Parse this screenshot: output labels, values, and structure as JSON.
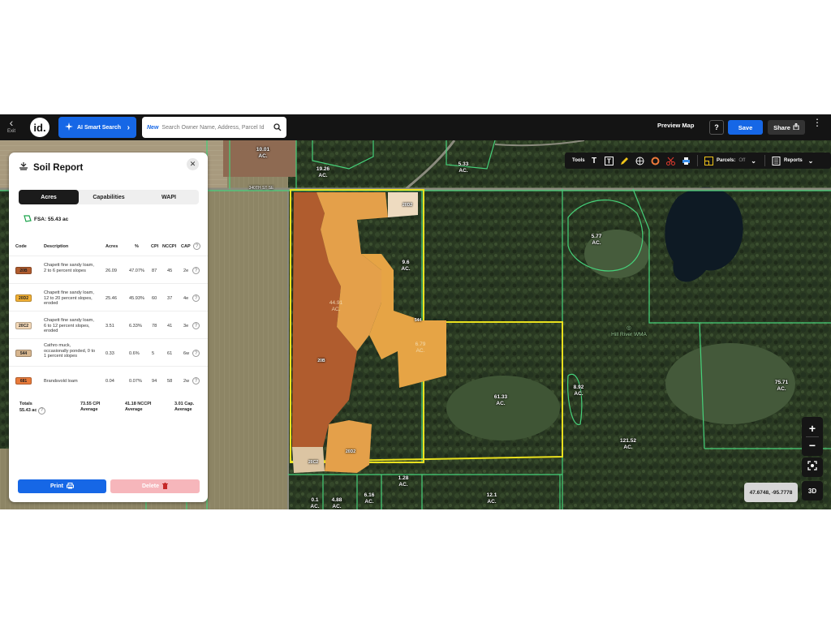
{
  "topbar": {
    "exit_label": "Exit",
    "logo_text": "id.",
    "ai_search_label": "AI Smart Search",
    "search_badge": "New",
    "search_placeholder": "Search Owner Name, Address, Parcel Id",
    "preview_label": "Preview Map",
    "help_label": "?",
    "save_label": "Save",
    "share_label": "Share"
  },
  "toolbar": {
    "tools_label": "Tools",
    "parcels_label": "Parcels:",
    "parcels_state": "Off",
    "reports_label": "Reports"
  },
  "map": {
    "acreage_labels": [
      {
        "value": "10.01",
        "unit": "AC."
      },
      {
        "value": "19.26",
        "unit": "AC."
      },
      {
        "value": "5.33",
        "unit": "AC."
      },
      {
        "value": "9.6",
        "unit": "AC."
      },
      {
        "value": "5.77",
        "unit": "AC."
      },
      {
        "value": "61.33",
        "unit": "AC."
      },
      {
        "value": "8.92",
        "unit": "AC."
      },
      {
        "value": "75.71",
        "unit": "AC."
      },
      {
        "value": "121.52",
        "unit": "AC."
      },
      {
        "value": "1.28",
        "unit": "AC."
      },
      {
        "value": "0.1",
        "unit": "AC."
      },
      {
        "value": "4.88",
        "unit": "AC."
      },
      {
        "value": "6.16",
        "unit": "AC."
      },
      {
        "value": "12.1",
        "unit": "AC."
      }
    ],
    "soil_labels": [
      {
        "value": "44.91",
        "unit": "AC."
      },
      {
        "value": "6.79",
        "unit": "AC."
      }
    ],
    "zone_codes": [
      "20B",
      "20D2",
      "20C2",
      "544",
      "20D2"
    ],
    "road_label": "340TH ST SE",
    "wma_label": "Hill River WMA",
    "coordinates": "47.6748, -95.7778",
    "zoom_in": "+",
    "zoom_out": "−",
    "three_d": "3D"
  },
  "panel": {
    "title": "Soil Report",
    "tabs": [
      {
        "label": "Acres",
        "active": true
      },
      {
        "label": "Capabilities",
        "active": false
      },
      {
        "label": "WAPI",
        "active": false
      }
    ],
    "fsa": "FSA: 55.43 ac",
    "columns": [
      "Code",
      "Description",
      "Acres",
      "%",
      "CPI",
      "NCCPI",
      "CAP"
    ],
    "rows": [
      {
        "code": "20B",
        "color": "#b05c2e",
        "description": "Chapett fine sandy loam, 2 to 6 percent slopes",
        "acres": "26.09",
        "pct": "47.07%",
        "cpi": "87",
        "nccpi": "45",
        "cap": "2e"
      },
      {
        "code": "20D2",
        "color": "#f2b035",
        "description": "Chapett fine sandy loam, 12 to 20 percent slopes, eroded",
        "acres": "25.46",
        "pct": "45.93%",
        "cpi": "60",
        "nccpi": "37",
        "cap": "4e"
      },
      {
        "code": "20C2",
        "color": "#f3d8b7",
        "description": "Chapett fine sandy loam, 6 to 12 percent slopes, eroded",
        "acres": "3.51",
        "pct": "6.33%",
        "cpi": "78",
        "nccpi": "41",
        "cap": "3e"
      },
      {
        "code": "544",
        "color": "#d6b58e",
        "description": "Cathro muck, occasionally ponded, 0 to 1 percent slopes",
        "acres": "0.33",
        "pct": "0.6%",
        "cpi": "5",
        "nccpi": "61",
        "cap": "6w"
      },
      {
        "code": "681",
        "color": "#e87a3a",
        "description": "Brandsvold loam",
        "acres": "0.04",
        "pct": "0.07%",
        "cpi": "94",
        "nccpi": "58",
        "cap": "2w"
      }
    ],
    "totals": {
      "label": "Totals",
      "acres": "55.43 ac",
      "cpi": "73.55 CPI",
      "cpi_sub": "Average",
      "nccpi": "41.18 NCCPI",
      "nccpi_sub": "Average",
      "cap": "3.01 Cap.",
      "cap_sub": "Average"
    },
    "print_label": "Print",
    "delete_label": "Delete"
  }
}
